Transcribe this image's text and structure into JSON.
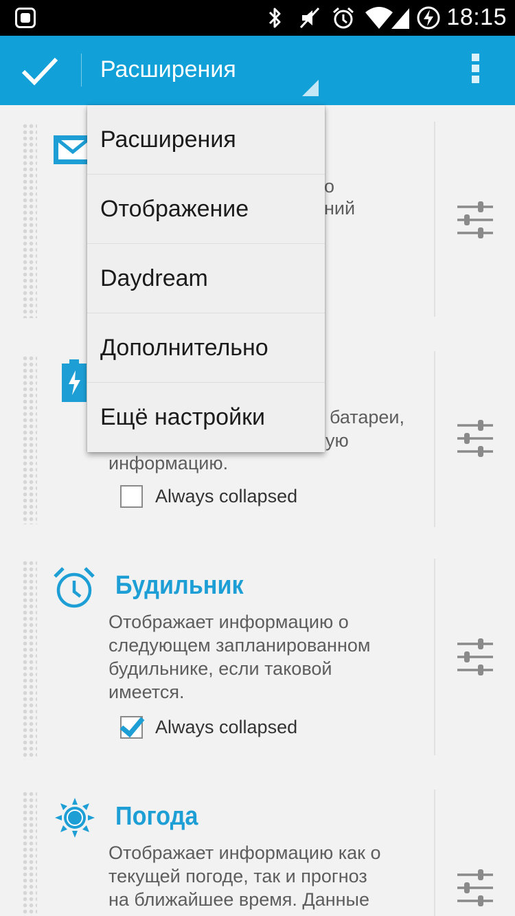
{
  "status_bar": {
    "time": "18:15",
    "icons": [
      "app-notification-icon",
      "bluetooth-icon",
      "mute-icon",
      "alarm-icon",
      "wifi-icon",
      "signal-icon",
      "battery-charging-icon"
    ]
  },
  "action_bar": {
    "title": "Расширения",
    "done_icon": "check-icon",
    "overflow_icon": "overflow-menu-icon",
    "color": "#11a0d7"
  },
  "dropdown": {
    "items": [
      {
        "label": "Расширения"
      },
      {
        "label": "Отображение"
      },
      {
        "label": "Daydream"
      },
      {
        "label": "Дополнительно"
      },
      {
        "label": "Ещё настройки"
      }
    ]
  },
  "extensions": [
    {
      "icon": "gmail-icon",
      "title": "",
      "desc_visible_fragment_1": "о",
      "desc_visible_fragment_2": "ний"
    },
    {
      "icon": "battery-icon",
      "title": "",
      "desc_visible_fragment_1": "батареи,",
      "desc_visible_fragment_2": "ую",
      "desc_line_3": "информацию.",
      "always_collapsed_label": "Always collapsed",
      "always_collapsed_checked": false
    },
    {
      "icon": "alarm-clock-icon",
      "title": "Будильник",
      "desc_lines": [
        "Отображает информацию о",
        "следующем запланированном",
        "будильнике, если таковой",
        "имеется."
      ],
      "always_collapsed_label": "Always collapsed",
      "always_collapsed_checked": true
    },
    {
      "icon": "weather-sun-icon",
      "title": "Погода",
      "desc_lines": [
        "Отображает информацию как о",
        "текущей погоде, так и прогноз",
        "на ближайшее время. Данные"
      ]
    }
  ],
  "accent_color": "#1d9fd6"
}
